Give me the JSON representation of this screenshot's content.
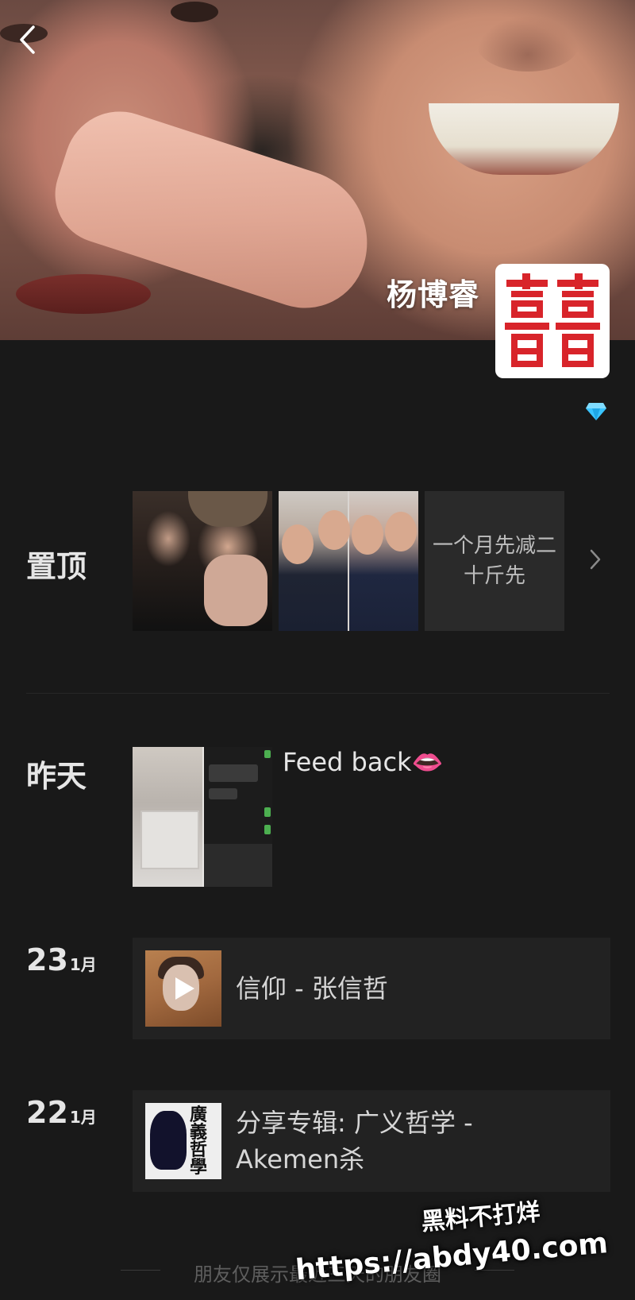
{
  "profile": {
    "nickname": "杨博睿"
  },
  "icons": {
    "back": "chevron-left-icon",
    "vip": "diamond-icon",
    "more": "chevron-right-icon",
    "play": "play-icon"
  },
  "pinned": {
    "label": "置顶",
    "text_post": "一个月先减二十斤先"
  },
  "yesterday": {
    "label": "昨天",
    "text": "Feed back👄"
  },
  "posts": [
    {
      "day": "23",
      "month": "1月",
      "title": "信仰 - 张信哲"
    },
    {
      "day": "22",
      "month": "1月",
      "title": "分享专辑: 广义哲学 - Akemen杀",
      "cover_text": "廣義哲學"
    }
  ],
  "footer": {
    "text": "朋友仅展示最近三天的朋友圈"
  },
  "watermark": {
    "line1": "黑料不打烊",
    "line2": "https://abdy40.com"
  },
  "colors": {
    "background": "#191919",
    "card": "#222222",
    "avatar_red": "#d8242a",
    "diamond": "#39c4ff"
  }
}
